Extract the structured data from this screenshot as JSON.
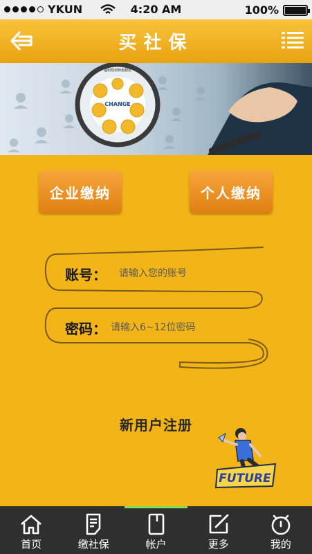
{
  "status_bar": {
    "carrier": "YKUN",
    "time": "4:20 AM",
    "battery": "100%",
    "battery_level": 1.0
  },
  "header": {
    "title": "买社保",
    "back_icon": "back-arrow-icon",
    "menu_icon": "menu-list-icon"
  },
  "banner": {
    "logo_text": "CHANGE",
    "caption": "福利规划特色服务"
  },
  "actions": {
    "enterprise_label": "企业缴纳",
    "personal_label": "个人缴纳"
  },
  "form": {
    "account_label": "账号：",
    "account_placeholder": "请输入您的账号",
    "password_label": "密码：",
    "password_placeholder": "请输入6~12位密码"
  },
  "register_label": "新用户注册",
  "mascot_text": "FUTURE",
  "tabbar": {
    "items": [
      {
        "label": "首页",
        "icon": "home-icon"
      },
      {
        "label": "缴社保",
        "icon": "document-icon"
      },
      {
        "label": "帐户",
        "icon": "account-card-icon"
      },
      {
        "label": "更多",
        "icon": "edit-icon"
      },
      {
        "label": "我的",
        "icon": "clock-icon"
      }
    ],
    "active_index": 2
  },
  "colors": {
    "background": "#f2b417",
    "header": "#f0ae22",
    "button": "#e98d20",
    "tabbar": "#2f2f2f",
    "active_tab_indicator": "#7fe05a"
  }
}
